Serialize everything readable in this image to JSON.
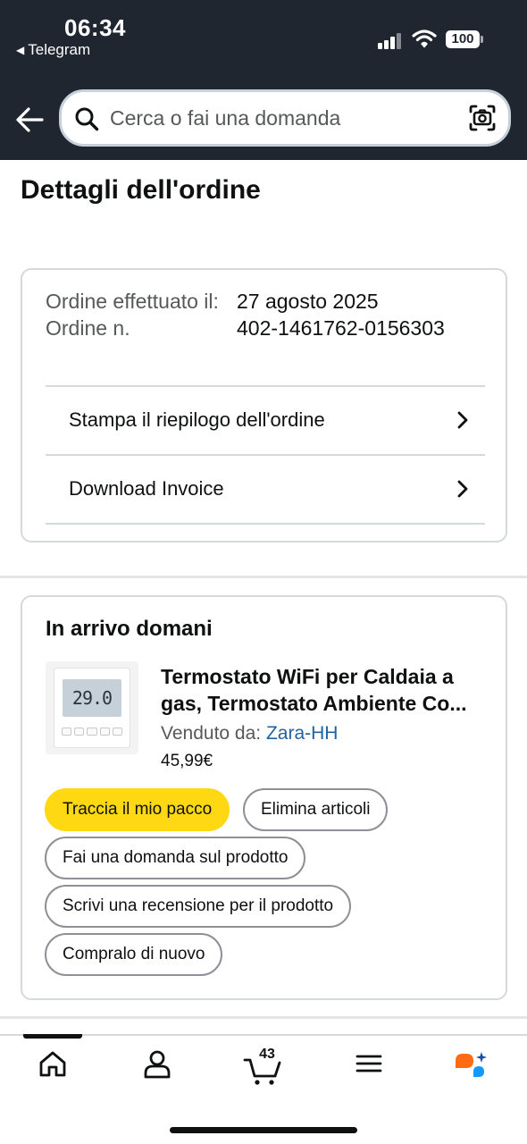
{
  "status_bar": {
    "time": "06:34",
    "back_app": "Telegram",
    "battery": "100"
  },
  "search": {
    "placeholder": "Cerca o fai una domanda"
  },
  "page": {
    "title": "Dettagli dell'ordine"
  },
  "order_summary": {
    "placed_label": "Ordine effettuato il:",
    "number_label": "Ordine n.",
    "placed_date": "27 agosto 2025",
    "order_number": "402-1461762-0156303",
    "links": [
      {
        "label": "Stampa il riepilogo dell'ordine"
      },
      {
        "label": "Download Invoice"
      }
    ]
  },
  "shipment": {
    "title": "In arrivo domani",
    "product": {
      "thumbnail_display": "29.0",
      "title": "Termostato WiFi per Caldaia a gas, Termostato Ambiente Co...",
      "sold_by_label": "Venduto da:",
      "seller": "Zara-HH",
      "price": "45,99€"
    },
    "actions": {
      "track": "Traccia il mio pacco",
      "delete": "Elimina articoli",
      "ask": "Fai una domanda sul prodotto",
      "review": "Scrivi una recensione per il prodotto",
      "buy_again": "Compralo di nuovo"
    }
  },
  "bottom_nav": {
    "cart_count": "43",
    "items": [
      "home-icon",
      "account-icon",
      "cart-icon",
      "menu-icon",
      "rufus-assistant-icon"
    ]
  },
  "colors": {
    "header_bg": "#1f2630",
    "primary_button": "#ffd814",
    "link": "#2162a1",
    "border": "#d5d9d9"
  }
}
